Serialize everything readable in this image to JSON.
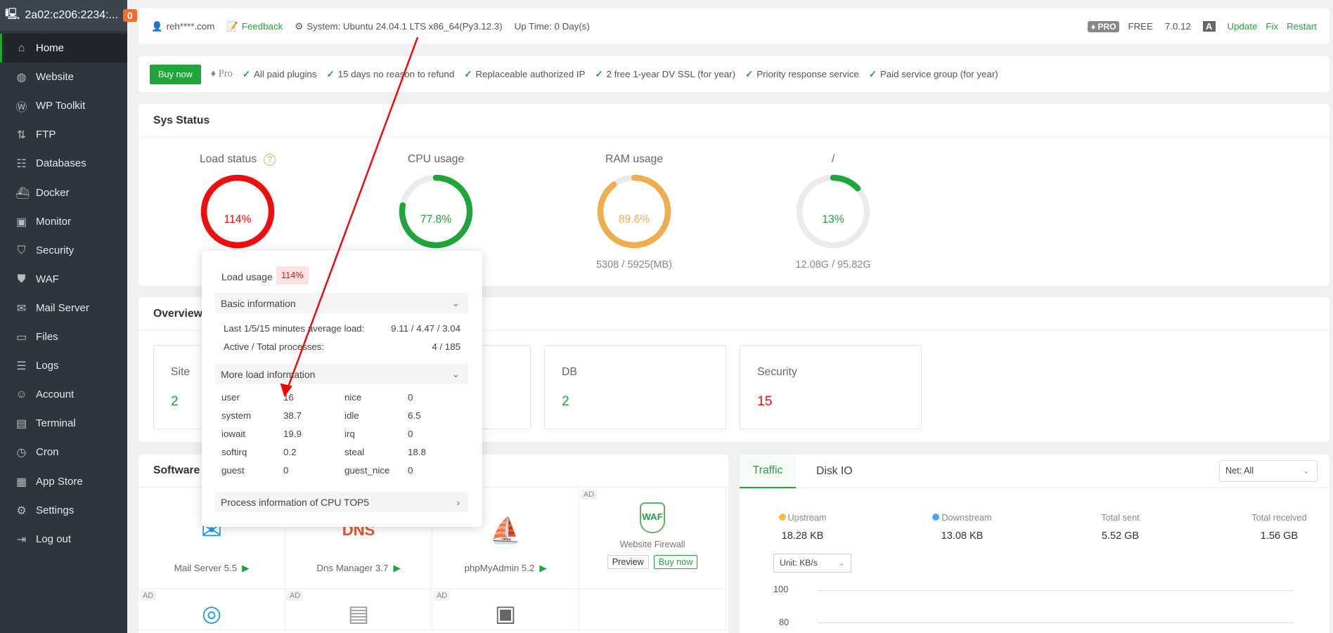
{
  "sidebar": {
    "host": "2a02:c206:2234:...",
    "badge": "0",
    "items": [
      {
        "label": "Home",
        "icon": "⌂"
      },
      {
        "label": "Website",
        "icon": "◍"
      },
      {
        "label": "WP Toolkit",
        "icon": "Ⓦ"
      },
      {
        "label": "FTP",
        "icon": "⇅"
      },
      {
        "label": "Databases",
        "icon": "☷"
      },
      {
        "label": "Docker",
        "icon": "⛴"
      },
      {
        "label": "Monitor",
        "icon": "▣"
      },
      {
        "label": "Security",
        "icon": "⛉"
      },
      {
        "label": "WAF",
        "icon": "⛊"
      },
      {
        "label": "Mail Server",
        "icon": "✉"
      },
      {
        "label": "Files",
        "icon": "▭"
      },
      {
        "label": "Logs",
        "icon": "☰"
      },
      {
        "label": "Account",
        "icon": "☺"
      },
      {
        "label": "Terminal",
        "icon": "▤"
      },
      {
        "label": "Cron",
        "icon": "◷"
      },
      {
        "label": "App Store",
        "icon": "▦"
      },
      {
        "label": "Settings",
        "icon": "⚙"
      },
      {
        "label": "Log out",
        "icon": "⇥"
      }
    ]
  },
  "topbar": {
    "user": "reh****.com",
    "feedback": "Feedback",
    "system": "System: Ubuntu 24.04.1 LTS x86_64(Py3.12.3)",
    "uptime": "Up Time: 0 Day(s)",
    "pro": "PRO",
    "free": "FREE",
    "version": "7.0.12",
    "update": "Update",
    "fix": "Fix",
    "restart": "Restart"
  },
  "promo": {
    "buy": "Buy now",
    "pro": "Pro",
    "features": [
      "All paid plugins",
      "15 days no reason to refund",
      "Replaceable authorized IP",
      "2 free 1-year DV SSL (for year)",
      "Priority response service",
      "Paid service group (for year)"
    ]
  },
  "sys": {
    "title": "Sys Status",
    "gauges": [
      {
        "title": "Load status",
        "value": "114%",
        "pct": 100,
        "color": "#f00d0d",
        "sub": ""
      },
      {
        "title": "CPU usage",
        "value": "77.8%",
        "pct": 77.8,
        "color": "#20a53a",
        "sub": ""
      },
      {
        "title": "RAM usage",
        "value": "89.6%",
        "pct": 89.6,
        "color": "#f0ad4e",
        "sub": "5308 / 5925(MB)"
      },
      {
        "title": "/",
        "value": "13%",
        "pct": 13,
        "color": "#20a53a",
        "sub": "12.08G / 95.82G"
      }
    ]
  },
  "overview": {
    "title": "Overview",
    "boxes": [
      {
        "label": "Site",
        "value": "2",
        "color": "#20a53a"
      },
      {
        "label": "DB",
        "value": "2",
        "color": "#20a53a"
      },
      {
        "label": "Security",
        "value": "15",
        "color": "#f00d0d"
      }
    ]
  },
  "popover": {
    "title": "Load usage",
    "value": "114%",
    "basic": "Basic information",
    "avg_label": "Last 1/5/15 minutes average load:",
    "avg_value": "9.11 / 4.47 / 3.04",
    "proc_label": "Active / Total processes:",
    "proc_value": "4 / 185",
    "more": "More load information",
    "stats": [
      [
        "user",
        "16",
        "nice",
        "0"
      ],
      [
        "system",
        "38.7",
        "idle",
        "6.5"
      ],
      [
        "iowait",
        "19.9",
        "irq",
        "0"
      ],
      [
        "softirq",
        "0.2",
        "steal",
        "18.8"
      ],
      [
        "guest",
        "0",
        "guest_nice",
        "0"
      ]
    ],
    "top5": "Process information of CPU TOP5"
  },
  "software": {
    "title": "Software",
    "ad": "AD",
    "apps": [
      "Mail Server 5.5",
      "Dns Manager 3.7",
      "phpMyAdmin 5.2"
    ],
    "waf": {
      "name": "Website Firewall",
      "icon_text": "WAF",
      "preview": "Preview",
      "buy": "Buy now"
    }
  },
  "traffic": {
    "tabs": [
      "Traffic",
      "Disk IO"
    ],
    "net": "Net: All",
    "unit": "Unit: KB/s",
    "stats": [
      {
        "label": "Upstream",
        "value": "18.28 KB"
      },
      {
        "label": "Downstream",
        "value": "13.08 KB"
      },
      {
        "label": "Total sent",
        "value": "5.52 GB"
      },
      {
        "label": "Total received",
        "value": "1.56 GB"
      }
    ],
    "yticks": [
      "100",
      "80"
    ]
  }
}
